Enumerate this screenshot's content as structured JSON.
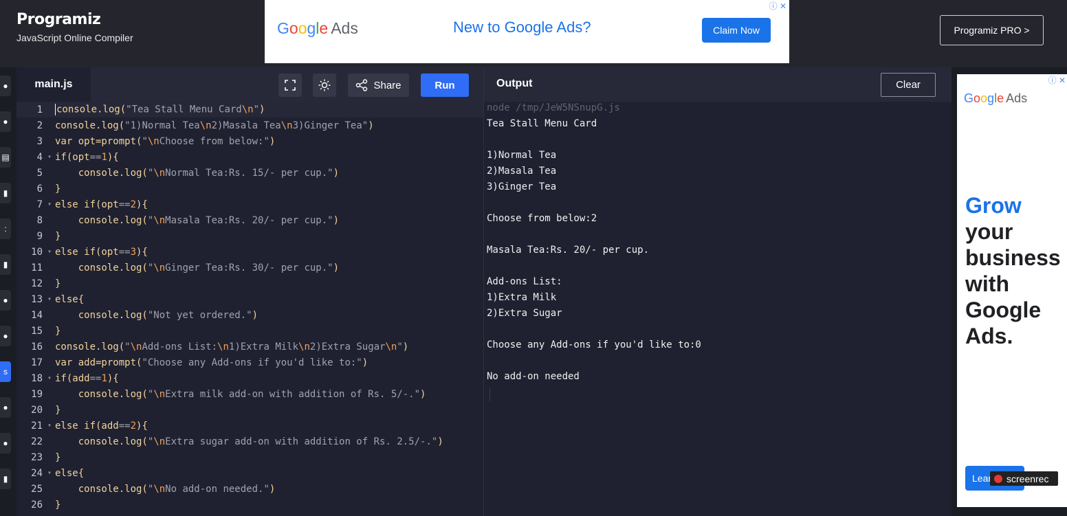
{
  "header": {
    "brand_name": "Programiz",
    "brand_subtitle": "JavaScript Online Compiler",
    "pro_button": "Programiz PRO >"
  },
  "top_ad": {
    "logo_parts": [
      "G",
      "o",
      "o",
      "g",
      "l",
      "e"
    ],
    "logo_suffix": "Ads",
    "headline": "New to Google Ads?",
    "cta": "Claim Now"
  },
  "editor": {
    "tab": "main.js",
    "share_label": "Share",
    "run_label": "Run",
    "lines": [
      {
        "n": "1",
        "fold": false,
        "html": "<span class=\"caret\"></span>console.log(<span class=\"s\">\"Tea Stall Menu Card</span><span class=\"e\">\\n</span><span class=\"s\">\"</span>)"
      },
      {
        "n": "2",
        "fold": false,
        "html": "console.log(<span class=\"s\">\"1)Normal Tea</span><span class=\"e\">\\n</span><span class=\"s\">2)Masala Tea</span><span class=\"e\">\\n</span><span class=\"s\">3)Ginger Tea\"</span>)"
      },
      {
        "n": "3",
        "fold": false,
        "html": "var opt=prompt(<span class=\"s\">\"</span><span class=\"e\">\\n</span><span class=\"s\">Choose from below:\"</span>)"
      },
      {
        "n": "4",
        "fold": true,
        "html": "if(opt<span class=\"s\">==</span><span class=\"e\">1</span>){"
      },
      {
        "n": "5",
        "fold": false,
        "html": "    console.log(<span class=\"s\">\"</span><span class=\"e\">\\n</span><span class=\"s\">Normal Tea:Rs. 15/- per cup.\"</span>)"
      },
      {
        "n": "6",
        "fold": false,
        "html": "}"
      },
      {
        "n": "7",
        "fold": true,
        "html": "else if(opt<span class=\"s\">==</span><span class=\"e\">2</span>){"
      },
      {
        "n": "8",
        "fold": false,
        "html": "    console.log(<span class=\"s\">\"</span><span class=\"e\">\\n</span><span class=\"s\">Masala Tea:Rs. 20/- per cup.\"</span>)"
      },
      {
        "n": "9",
        "fold": false,
        "html": "}"
      },
      {
        "n": "10",
        "fold": true,
        "html": "else if(opt<span class=\"s\">==</span><span class=\"e\">3</span>){"
      },
      {
        "n": "11",
        "fold": false,
        "html": "    console.log(<span class=\"s\">\"</span><span class=\"e\">\\n</span><span class=\"s\">Ginger Tea:Rs. 30/- per cup.\"</span>)"
      },
      {
        "n": "12",
        "fold": false,
        "html": "}"
      },
      {
        "n": "13",
        "fold": true,
        "html": "else{"
      },
      {
        "n": "14",
        "fold": false,
        "html": "    console.log(<span class=\"s\">\"Not yet ordered.\"</span>)"
      },
      {
        "n": "15",
        "fold": false,
        "html": "}"
      },
      {
        "n": "16",
        "fold": false,
        "html": "console.log(<span class=\"s\">\"</span><span class=\"e\">\\n</span><span class=\"s\">Add-ons List:</span><span class=\"e\">\\n</span><span class=\"s\">1)Extra Milk</span><span class=\"e\">\\n</span><span class=\"s\">2)Extra Sugar</span><span class=\"e\">\\n</span><span class=\"s\">\"</span>)"
      },
      {
        "n": "17",
        "fold": false,
        "html": "var add=prompt(<span class=\"s\">\"Choose any Add-ons if you'd like to:\"</span>)"
      },
      {
        "n": "18",
        "fold": true,
        "html": "if(add<span class=\"s\">==</span><span class=\"e\">1</span>){"
      },
      {
        "n": "19",
        "fold": false,
        "html": "    console.log(<span class=\"s\">\"</span><span class=\"e\">\\n</span><span class=\"s\">Extra milk add-on with addition of Rs. 5/-.\"</span>)"
      },
      {
        "n": "20",
        "fold": false,
        "html": "}"
      },
      {
        "n": "21",
        "fold": true,
        "html": "else if(add<span class=\"s\">==</span><span class=\"e\">2</span>){"
      },
      {
        "n": "22",
        "fold": false,
        "html": "    console.log(<span class=\"s\">\"</span><span class=\"e\">\\n</span><span class=\"s\">Extra sugar add-on with addition of Rs. 2.5/-.\"</span>)"
      },
      {
        "n": "23",
        "fold": false,
        "html": "}"
      },
      {
        "n": "24",
        "fold": true,
        "html": "else{"
      },
      {
        "n": "25",
        "fold": false,
        "html": "    console.log(<span class=\"s\">\"</span><span class=\"e\">\\n</span><span class=\"s\">No add-on needed.\"</span>)"
      },
      {
        "n": "26",
        "fold": false,
        "html": "}"
      }
    ]
  },
  "output": {
    "title": "Output",
    "clear_label": "Clear",
    "lines": [
      {
        "text": "node /tmp/JeW5NSnupG.js",
        "dim": true
      },
      {
        "text": "Tea Stall Menu Card",
        "dim": false
      },
      {
        "text": "",
        "dim": false
      },
      {
        "text": "1)Normal Tea",
        "dim": false
      },
      {
        "text": "2)Masala Tea",
        "dim": false
      },
      {
        "text": "3)Ginger Tea",
        "dim": false
      },
      {
        "text": "",
        "dim": false
      },
      {
        "text": "Choose from below:2",
        "dim": false
      },
      {
        "text": "",
        "dim": false
      },
      {
        "text": "Masala Tea:Rs. 20/- per cup.",
        "dim": false
      },
      {
        "text": "",
        "dim": false
      },
      {
        "text": "Add-ons List:",
        "dim": false
      },
      {
        "text": "1)Extra Milk",
        "dim": false
      },
      {
        "text": "2)Extra Sugar",
        "dim": false
      },
      {
        "text": "",
        "dim": false
      },
      {
        "text": "Choose any Add-ons if you'd like to:0",
        "dim": false
      },
      {
        "text": "",
        "dim": false
      },
      {
        "text": "No add-on needed",
        "dim": false
      }
    ]
  },
  "side_ad": {
    "logo_suffix": "Ads",
    "headline_accent": "Grow",
    "headline_rest": "your business with Google Ads.",
    "cta": "Lear",
    "watermark": "screenrec"
  }
}
